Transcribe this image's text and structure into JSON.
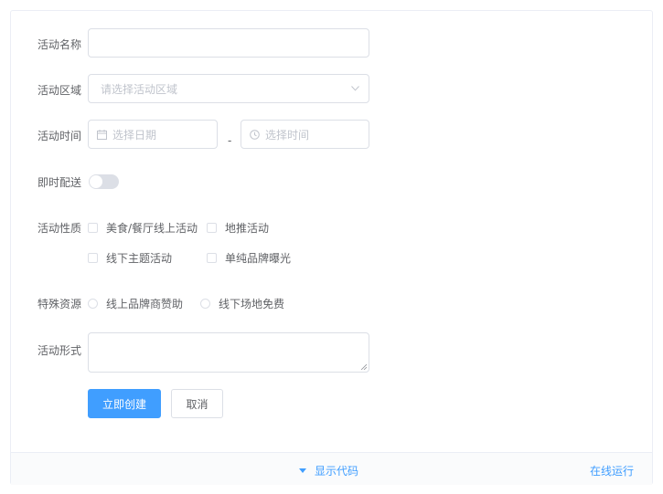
{
  "form": {
    "name_label": "活动名称",
    "region_label": "活动区域",
    "region_placeholder": "请选择活动区域",
    "time_label": "活动时间",
    "date_placeholder": "选择日期",
    "time_placeholder": "选择时间",
    "separator": "-",
    "delivery_label": "即时配送",
    "delivery_on": false,
    "type_label": "活动性质",
    "type_options": [
      "美食/餐厅线上活动",
      "地推活动",
      "线下主题活动",
      "单纯品牌曝光"
    ],
    "resource_label": "特殊资源",
    "resource_options": [
      "线上品牌商赞助",
      "线下场地免费"
    ],
    "desc_label": "活动形式",
    "submit_label": "立即创建",
    "cancel_label": "取消"
  },
  "footer": {
    "toggle_label": "显示代码",
    "run_label": "在线运行"
  },
  "colors": {
    "primary": "#409eff",
    "border": "#dcdfe6",
    "placeholder": "#c0c4cc",
    "text": "#606266"
  },
  "icons": {
    "select": "chevron-down-icon",
    "date": "calendar-icon",
    "time": "clock-icon",
    "toggle": "caret-down-icon"
  }
}
